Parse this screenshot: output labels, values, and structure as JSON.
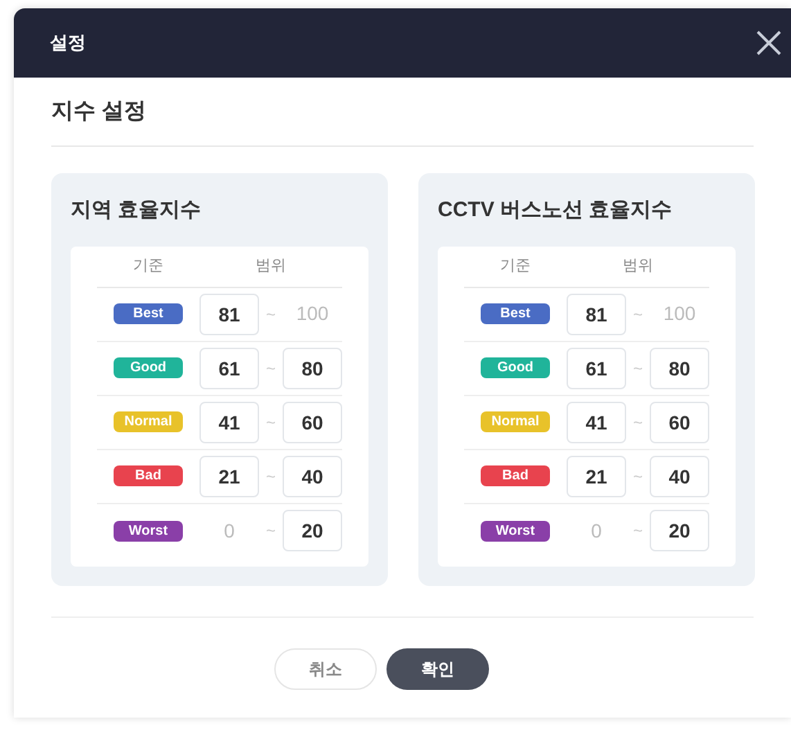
{
  "window": {
    "title": "설정"
  },
  "section_title": "지수 설정",
  "panels": [
    {
      "title": "지역 효율지수",
      "columns": [
        "기준",
        "범위"
      ],
      "rows": [
        {
          "grade": "Best",
          "color": "#4a6cc4",
          "min": {
            "value": "81",
            "editable": true
          },
          "max": {
            "value": "100",
            "editable": false
          }
        },
        {
          "grade": "Good",
          "color": "#20b49a",
          "min": {
            "value": "61",
            "editable": true
          },
          "max": {
            "value": "80",
            "editable": true
          }
        },
        {
          "grade": "Normal",
          "color": "#e8c22a",
          "min": {
            "value": "41",
            "editable": true
          },
          "max": {
            "value": "60",
            "editable": true
          }
        },
        {
          "grade": "Bad",
          "color": "#e8434e",
          "min": {
            "value": "21",
            "editable": true
          },
          "max": {
            "value": "40",
            "editable": true
          }
        },
        {
          "grade": "Worst",
          "color": "#8a3fa8",
          "min": {
            "value": "0",
            "editable": false
          },
          "max": {
            "value": "20",
            "editable": true
          }
        }
      ]
    },
    {
      "title": "CCTV 버스노선 효율지수",
      "columns": [
        "기준",
        "범위"
      ],
      "rows": [
        {
          "grade": "Best",
          "color": "#4a6cc4",
          "min": {
            "value": "81",
            "editable": true
          },
          "max": {
            "value": "100",
            "editable": false
          }
        },
        {
          "grade": "Good",
          "color": "#20b49a",
          "min": {
            "value": "61",
            "editable": true
          },
          "max": {
            "value": "80",
            "editable": true
          }
        },
        {
          "grade": "Normal",
          "color": "#e8c22a",
          "min": {
            "value": "41",
            "editable": true
          },
          "max": {
            "value": "60",
            "editable": true
          }
        },
        {
          "grade": "Bad",
          "color": "#e8434e",
          "min": {
            "value": "21",
            "editable": true
          },
          "max": {
            "value": "40",
            "editable": true
          }
        },
        {
          "grade": "Worst",
          "color": "#8a3fa8",
          "min": {
            "value": "0",
            "editable": false
          },
          "max": {
            "value": "20",
            "editable": true
          }
        }
      ]
    }
  ],
  "separator": "~",
  "buttons": [
    {
      "label": "취소",
      "kind": "secondary"
    },
    {
      "label": "확인",
      "kind": "primary"
    }
  ]
}
